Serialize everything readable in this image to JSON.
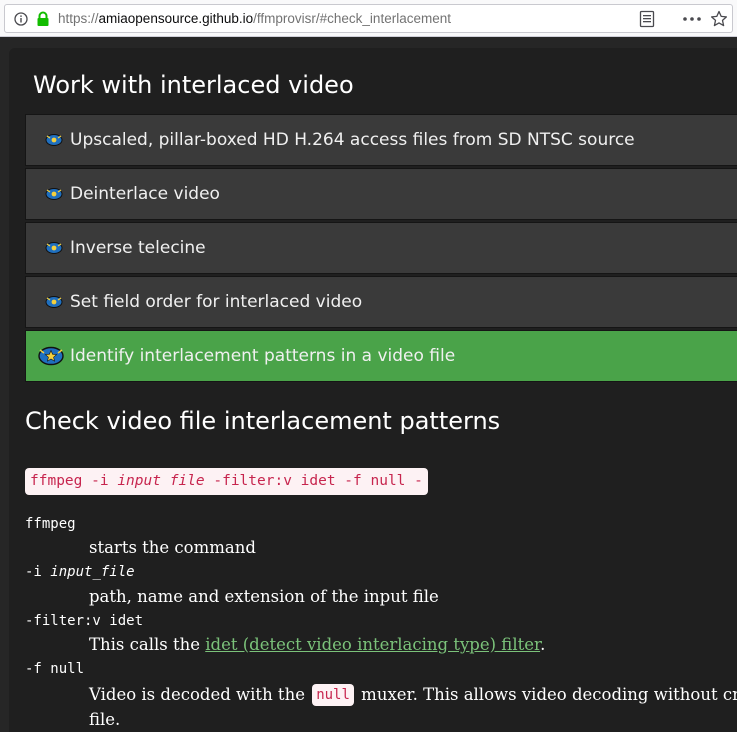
{
  "browser": {
    "url_scheme": "https://",
    "url_host": "amiaopensource.github.io",
    "url_path": "/ffmprovisr/#check_interlacement",
    "icons": [
      "info-icon",
      "lock-icon",
      "reader-view-icon",
      "more-icon",
      "bookmark-star-icon"
    ]
  },
  "section": {
    "title": "Work with interlaced video",
    "recipes": [
      {
        "label": "Upscaled, pillar-boxed HD H.264 access files from SD NTSC source",
        "active": false
      },
      {
        "label": "Deinterlace video",
        "active": false
      },
      {
        "label": "Inverse telecine",
        "active": false
      },
      {
        "label": "Set field order for interlaced video",
        "active": false
      },
      {
        "label": "Identify interlacement patterns in a video file",
        "active": true
      }
    ],
    "recipe_icon": "film-reel-icon"
  },
  "content": {
    "heading": "Check video file interlacement patterns",
    "command": {
      "pre": "ffmpeg -i ",
      "italic": "input file",
      "post": " -filter:v idet -f null -"
    },
    "defs": {
      "d1_term": "ffmpeg",
      "d1_desc": "starts the command",
      "d2_term_pre": "-i ",
      "d2_term_italic": "input_file",
      "d2_desc": "path, name and extension of the input file",
      "d3_term": "-filter:v idet",
      "d3_desc_pre": "This calls the ",
      "d3_link": "idet (detect video interlacing type) filter",
      "d3_desc_post": ".",
      "d4_term": "-f null",
      "d4_desc_pre": "Video is decoded with the ",
      "d4_code": "null",
      "d4_desc_post": " muxer. This allows video decoding without creatin",
      "d4_desc_line2": "file."
    }
  },
  "colors": {
    "active_recipe": "#4aa349",
    "recipe_bg": "#3a3a3a",
    "code_text": "#c7254e",
    "code_bg": "#fdf2f4",
    "link": "#7bc27a",
    "lock": "#12bc00"
  }
}
